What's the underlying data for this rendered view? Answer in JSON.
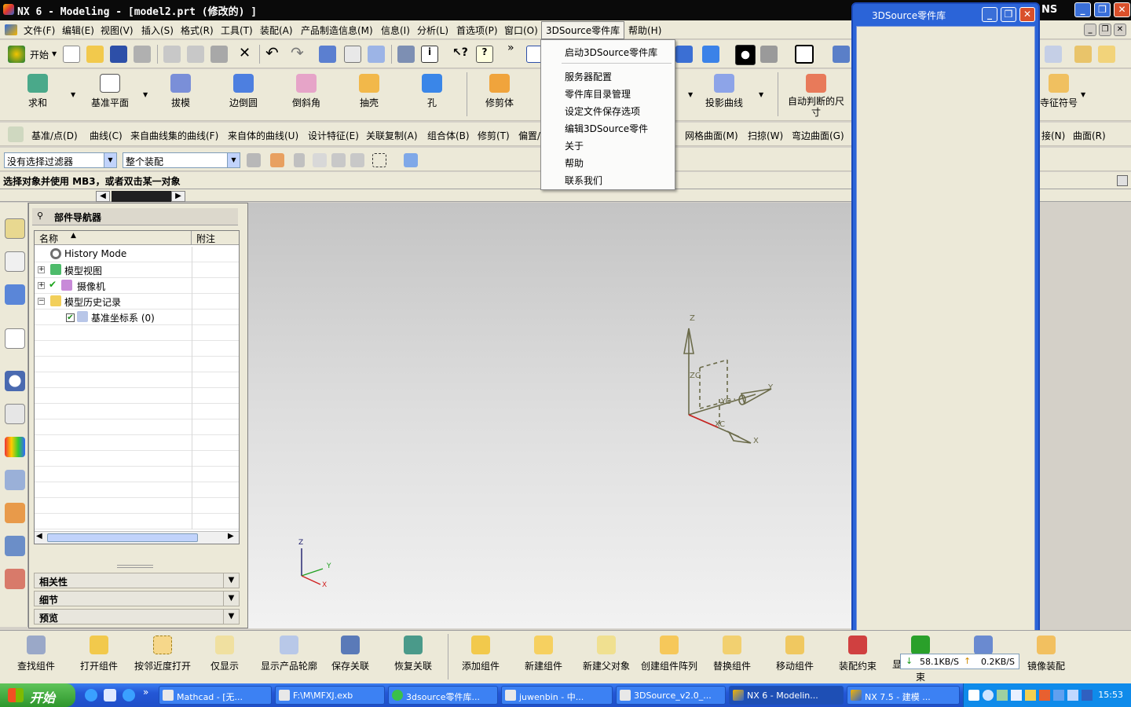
{
  "window": {
    "title": "NX 6 - Modeling - [model2.prt  (修改的) ]",
    "brand_fragment": "NS"
  },
  "menubar": [
    "文件(F)",
    "编辑(E)",
    "视图(V)",
    "插入(S)",
    "格式(R)",
    "工具(T)",
    "装配(A)",
    "产品制造信息(M)",
    "信息(I)",
    "分析(L)",
    "首选项(P)",
    "窗口(O)",
    "3DSource零件库",
    "帮助(H)"
  ],
  "toolbar1": {
    "start_label": "开始",
    "more": "»"
  },
  "feature_buttons": [
    "求和",
    "基准平面",
    "拔模",
    "边倒圆",
    "倒斜角",
    "抽壳",
    "孔",
    "修剪体",
    "投影曲线",
    "自动判断的尺寸",
    "特征符号"
  ],
  "feature_buttons_partial": {
    "auto_dim_line1": "自动判断的尺",
    "auto_dim_line2": "寸",
    "feature_symbol_fragment": "寺征符号"
  },
  "toolbar3_left": [
    "基准/点(D)",
    "曲线(C)",
    "来自曲线集的曲线(F)",
    "来自体的曲线(U)",
    "设计特征(E)",
    "关联复制(A)",
    "组合体(B)",
    "修剪(T)",
    "偏置/"
  ],
  "toolbar3_right": [
    "网格曲面(M)",
    "扫掠(W)",
    "弯边曲面(G)"
  ],
  "toolbar3_far": [
    "接(N)",
    "曲面(R)"
  ],
  "filters": {
    "selection_filter": "没有选择过滤器",
    "scope": "整个装配"
  },
  "status_text": "选择对象并使用 MB3，或者双击某一对象",
  "navigator": {
    "title": "部件导航器",
    "columns": [
      "名称",
      "附注"
    ],
    "rows": [
      {
        "label": "History Mode",
        "level": 0,
        "expander": ""
      },
      {
        "label": "模型视图",
        "level": 0,
        "expander": "+"
      },
      {
        "label": "摄像机",
        "level": 0,
        "expander": "+"
      },
      {
        "label": "模型历史记录",
        "level": 0,
        "expander": "−"
      },
      {
        "label": "基准坐标系 (0)",
        "level": 1,
        "expander": ""
      }
    ],
    "sections": [
      "相关性",
      "细节",
      "预览"
    ]
  },
  "viewport": {
    "csys_labels": {
      "z": "Z",
      "y": "Y",
      "x": "X",
      "zc": "ZC",
      "yc": "YC",
      "xc": "XC"
    },
    "mini_triad": {
      "z": "Z",
      "y": "Y",
      "x": "X"
    }
  },
  "dropdown_3dsource": {
    "items": [
      "启动3DSource零件库",
      "服务器配置",
      "零件库目录管理",
      "设定文件保存选项",
      "编辑3DSource零件",
      "关于",
      "帮助",
      "联系我们"
    ]
  },
  "source_window": {
    "title": "3DSource零件库"
  },
  "bottom_toolbar": {
    "buttons": [
      "查找组件",
      "打开组件",
      "按邻近度打开",
      "仅显示",
      "显示产品轮廓",
      "保存关联",
      "恢复关联",
      "添加组件",
      "新建组件",
      "新建父对象",
      "创建组件阵列",
      "替换组件",
      "移动组件",
      "装配约束",
      "显示和隐藏约束",
      "镜像装配"
    ],
    "partial_fragment_1": "显",
    "partial_fragment_2": "束"
  },
  "netmeter": {
    "down": "58.1KB/S",
    "up": "0.2KB/S"
  },
  "taskbar": {
    "start": "开始",
    "tasks": [
      "Mathcad - [无...",
      "F:\\M\\MFXJ.exb",
      "3dsource零件库...",
      "juwenbin - 中...",
      "3DSource_v2.0_...",
      "NX 6 - Modelin...",
      "NX 7.5 - 建模 ..."
    ],
    "clock": "15:53"
  },
  "colors": {
    "accent_blue": "#2b64d8",
    "taskbar_blue": "#245edb",
    "start_green": "#3aa83a",
    "csys_olive": "#6b6b4a"
  }
}
